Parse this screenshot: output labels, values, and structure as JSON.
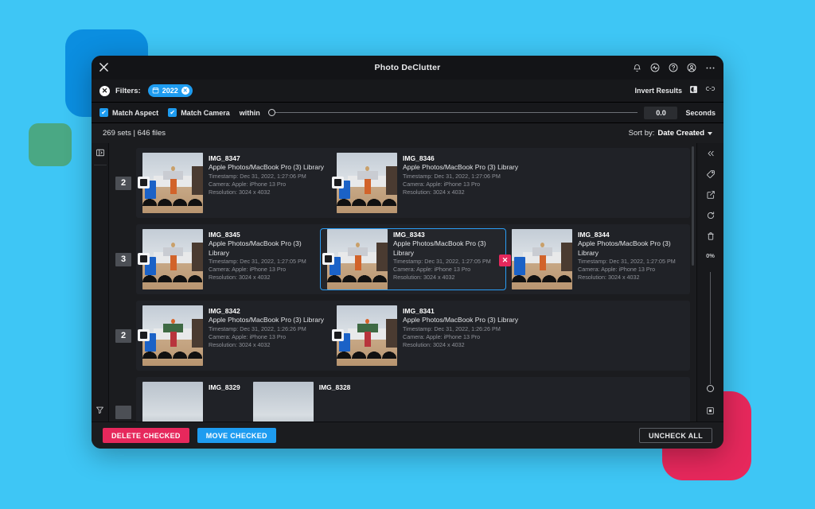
{
  "window": {
    "title": "Photo DeClutter",
    "close_icon": "close-icon",
    "titlebar_icons": [
      "bell-icon",
      "activity-icon",
      "help-icon",
      "account-icon",
      "more-icon"
    ]
  },
  "filters": {
    "clear_icon": "clear-filters-icon",
    "label": "Filters:",
    "chips": [
      {
        "icon": "calendar-icon",
        "text": "2022",
        "remove_icon": "chip-remove-icon"
      }
    ],
    "invert_label": "Invert Results",
    "invert_icon": "invert-icon",
    "link_icon": "link-icon"
  },
  "match": {
    "aspect_label": "Match Aspect",
    "aspect_checked": true,
    "camera_label": "Match Camera",
    "camera_checked": true,
    "within_label": "within",
    "value": "0.0",
    "unit": "Seconds",
    "check_glyph": "✔"
  },
  "counts": {
    "summary": "269 sets  |  646 files",
    "sort_by_label": "Sort by:",
    "sort_value": "Date Created"
  },
  "left_rail": {
    "items": [
      {
        "icon": "panel-toggle-icon"
      },
      {
        "icon": "funnel-filter-icon"
      }
    ]
  },
  "right_rail": {
    "collapse_icon": "collapse-chevrons-icon",
    "items": [
      "tag-icon",
      "export-icon",
      "rotate-icon",
      "trash-icon"
    ],
    "percent": "0%",
    "bottom_icon": "fit-view-icon"
  },
  "results": {
    "sets": [
      {
        "count": "2",
        "items": [
          {
            "name": "IMG_8347",
            "library": "Apple Photos/MacBook Pro (3) Library",
            "timestamp": "Timestamp: Dec 31, 2022, 1:27:06 PM",
            "camera": "Camera: Apple: iPhone 13 Pro",
            "resolution": "Resolution: 3024 x 4032",
            "selected": false,
            "checkbox": true,
            "thumb": "person-orange",
            "delete_badge": false
          },
          {
            "name": "IMG_8346",
            "library": "Apple Photos/MacBook Pro (3) Library",
            "timestamp": "Timestamp: Dec 31, 2022, 1:27:06 PM",
            "camera": "Camera: Apple: iPhone 13 Pro",
            "resolution": "Resolution: 3024 x 4032",
            "selected": false,
            "checkbox": true,
            "thumb": "person-orange",
            "delete_badge": false
          }
        ]
      },
      {
        "count": "3",
        "items": [
          {
            "name": "IMG_8345",
            "library": "Apple Photos/MacBook Pro (3) Library",
            "timestamp": "Timestamp: Dec 31, 2022, 1:27:05 PM",
            "camera": "Camera: Apple: iPhone 13 Pro",
            "resolution": "Resolution: 3024 x 4032",
            "selected": false,
            "checkbox": true,
            "thumb": "person-orange",
            "delete_badge": false
          },
          {
            "name": "IMG_8343",
            "library": "Apple Photos/MacBook Pro (3) Library",
            "timestamp": "Timestamp: Dec 31, 2022, 1:27:05 PM",
            "camera": "Camera: Apple: iPhone 13 Pro",
            "resolution": "Resolution: 3024 x 4032",
            "selected": true,
            "checkbox": true,
            "thumb": "person-orange",
            "delete_badge": false
          },
          {
            "name": "IMG_8344",
            "library": "Apple Photos/MacBook Pro (3) Library",
            "timestamp": "Timestamp: Dec 31, 2022, 1:27:05 PM",
            "camera": "Camera: Apple: iPhone 13 Pro",
            "resolution": "Resolution: 3024 x 4032",
            "selected": false,
            "checkbox": false,
            "thumb": "person-orange",
            "delete_badge": true,
            "delete_glyph": "✕"
          }
        ]
      },
      {
        "count": "2",
        "items": [
          {
            "name": "IMG_8342",
            "library": "Apple Photos/MacBook Pro (3) Library",
            "timestamp": "Timestamp: Dec 31, 2022, 1:26:26 PM",
            "camera": "Camera: Apple: iPhone 13 Pro",
            "resolution": "Resolution: 3024 x 4032",
            "selected": false,
            "checkbox": true,
            "thumb": "person-green",
            "delete_badge": false
          },
          {
            "name": "IMG_8341",
            "library": "Apple Photos/MacBook Pro (3) Library",
            "timestamp": "Timestamp: Dec 31, 2022, 1:26:26 PM",
            "camera": "Camera: Apple: iPhone 13 Pro",
            "resolution": "Resolution: 3024 x 4032",
            "selected": false,
            "checkbox": true,
            "thumb": "person-green",
            "delete_badge": false
          }
        ]
      },
      {
        "count": "",
        "items": [
          {
            "name": "IMG_8329",
            "library": "",
            "timestamp": "",
            "camera": "",
            "resolution": "",
            "selected": false,
            "checkbox": false,
            "thumb": "sky",
            "delete_badge": false
          },
          {
            "name": "IMG_8328",
            "library": "",
            "timestamp": "",
            "camera": "",
            "resolution": "",
            "selected": false,
            "checkbox": false,
            "thumb": "sky",
            "delete_badge": false
          }
        ]
      }
    ]
  },
  "footer": {
    "delete_label": "DELETE CHECKED",
    "move_label": "MOVE CHECKED",
    "uncheck_label": "UNCHECK ALL"
  },
  "colors": {
    "accent_blue": "#1e9cf0",
    "danger_pink": "#e6285c",
    "background": "#3ec6f5",
    "window_bg": "#1b1c1f",
    "deco_blue": "#0b8ee0",
    "deco_green": "#4aa884"
  }
}
